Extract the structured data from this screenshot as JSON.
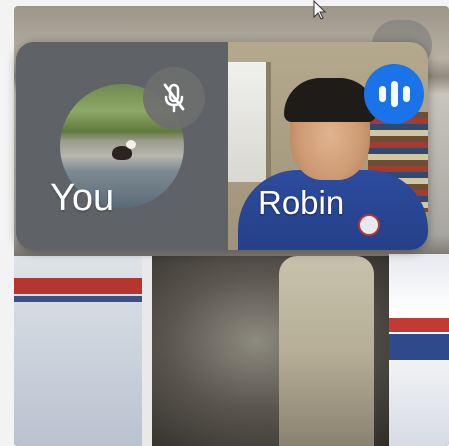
{
  "participants": {
    "you": {
      "name": "You",
      "mic_state": "muted",
      "mic_icon": "mic-off-icon"
    },
    "robin": {
      "name": "Robin",
      "speaking_icon": "audio-level-icon",
      "speaking_color": "#1a73e8"
    }
  },
  "colors": {
    "panel_bg": "#5f6368",
    "speaking_blue": "#1a73e8",
    "label_text": "#ffffff"
  }
}
